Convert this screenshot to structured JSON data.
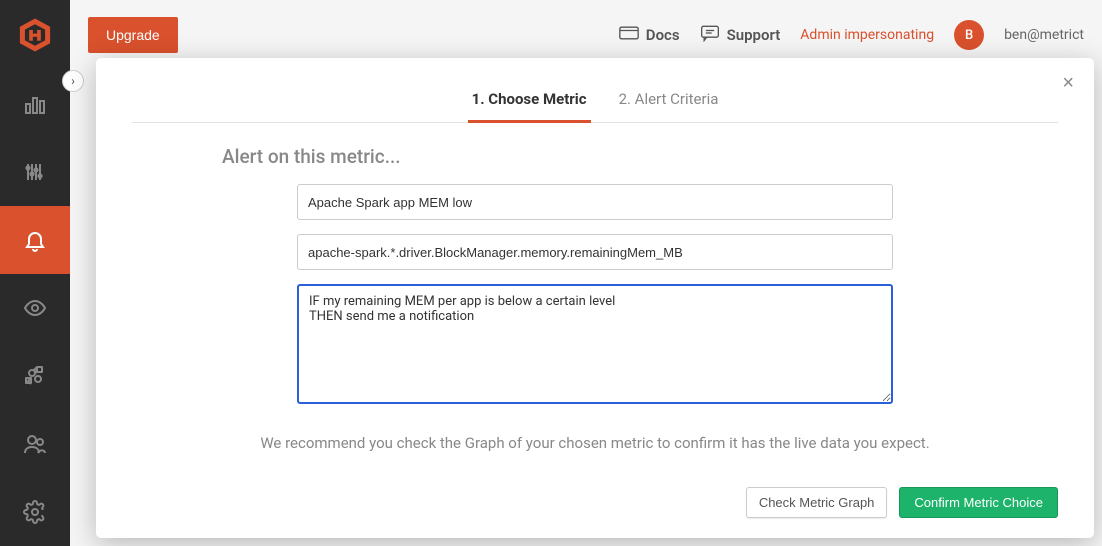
{
  "sidebar": {
    "items": [
      {
        "name": "dashboards"
      },
      {
        "name": "metrics"
      },
      {
        "name": "alerts",
        "active": true
      },
      {
        "name": "watchers"
      },
      {
        "name": "integrations"
      },
      {
        "name": "team"
      },
      {
        "name": "settings"
      }
    ]
  },
  "topbar": {
    "upgrade_label": "Upgrade",
    "docs_label": "Docs",
    "support_label": "Support",
    "impersonate_label": "Admin impersonating",
    "avatar_initial": "B",
    "user_email": "ben@metrict"
  },
  "modal": {
    "tabs": [
      {
        "label": "1. Choose Metric",
        "active": true
      },
      {
        "label": "2. Alert Criteria",
        "active": false
      }
    ],
    "section_title": "Alert on this metric...",
    "alert_name_value": "Apache Spark app MEM low",
    "metric_value": "apache-spark.*.driver.BlockManager.memory.remainingMem_MB",
    "description_value": "IF my remaining MEM per app is below a certain level\nTHEN send me a notification",
    "recommend_text": "We recommend you check the Graph of your chosen metric to confirm it has the live data you expect.",
    "check_graph_label": "Check Metric Graph",
    "confirm_label": "Confirm Metric Choice"
  }
}
